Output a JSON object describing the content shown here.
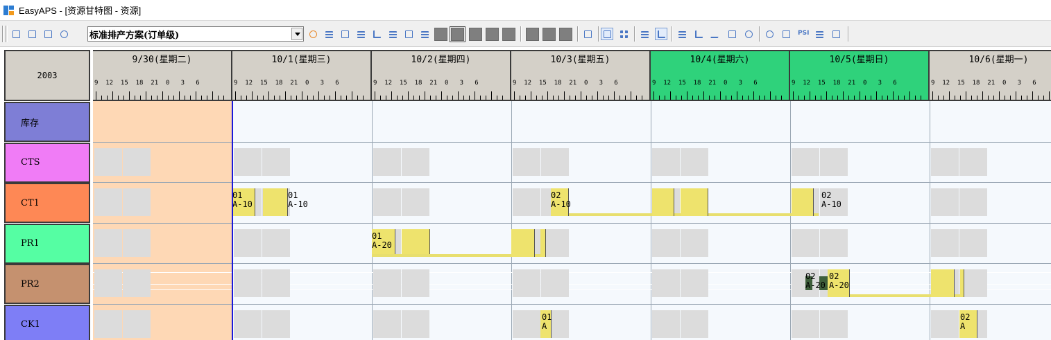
{
  "window": {
    "title": "EasyAPS - [资源甘特图 - 资源]",
    "app_icon": "easyaps-logo-icon"
  },
  "toolbar": {
    "scheme_value": "标准排产方案(订单级)",
    "icons": [
      "save-icon",
      "print-icon",
      "print-preview-icon",
      "printer-settings-icon",
      "refresh-icon",
      "settings-list-icon",
      "copy-icon",
      "split-icon",
      "filter-icon",
      "align-icon",
      "lock-icon",
      "scatter-icon",
      "gray-block-1",
      "gray-block-2",
      "gray-block-3",
      "gray-block-4",
      "gray-block-5",
      "gray-block-6",
      "gray-block-7",
      "gray-block-8",
      "edit-icon",
      "report-icon",
      "grid-icon",
      "text-align-icon",
      "bar-chart-icon",
      "list-icon",
      "area-chart-icon",
      "line-chart-icon",
      "home-icon",
      "info-icon",
      "bell-icon",
      "document-icon",
      "psi-icon",
      "table-icon",
      "image-icon"
    ],
    "psi_label": "PSI"
  },
  "gantt": {
    "year": "2003",
    "hour_ticks": "9  12  15  18  21  0   3   6",
    "days": [
      {
        "label": "9/30(星期二)",
        "weekend": false
      },
      {
        "label": "10/1(星期三)",
        "weekend": false
      },
      {
        "label": "10/2(星期四)",
        "weekend": false
      },
      {
        "label": "10/3(星期五)",
        "weekend": false
      },
      {
        "label": "10/4(星期六)",
        "weekend": true
      },
      {
        "label": "10/5(星期日)",
        "weekend": true
      },
      {
        "label": "10/6(星期一)",
        "weekend": false
      }
    ],
    "resources": [
      {
        "name": "库存",
        "color": "#7e7ed6"
      },
      {
        "name": "CTS",
        "color": "#f07cf6"
      },
      {
        "name": "CT1",
        "color": "#fe8855"
      },
      {
        "name": "PR1",
        "color": "#55fea3"
      },
      {
        "name": "PR2",
        "color": "#c5916f"
      },
      {
        "name": "CK1",
        "color": "#7e7ef6"
      }
    ],
    "op_labels": {
      "ct1_a": "01\nA-10",
      "ct1_b": "01\nA-10",
      "ct1_c": "02\nA-10",
      "ct1_d": "02\nA-10",
      "pr1_a": "01\nA-20",
      "pr2_a": "02\nA-20",
      "pr2_b": "02\nA-20",
      "ck1_a": "01\nA",
      "ck1_b": "02\nA"
    },
    "colors": {
      "operation": "#eee36d",
      "past_shade": "#fed8b5",
      "today_line": "#1a1adb",
      "weekend_header": "#2fd27b",
      "offtime": "#dcdcdc"
    }
  }
}
